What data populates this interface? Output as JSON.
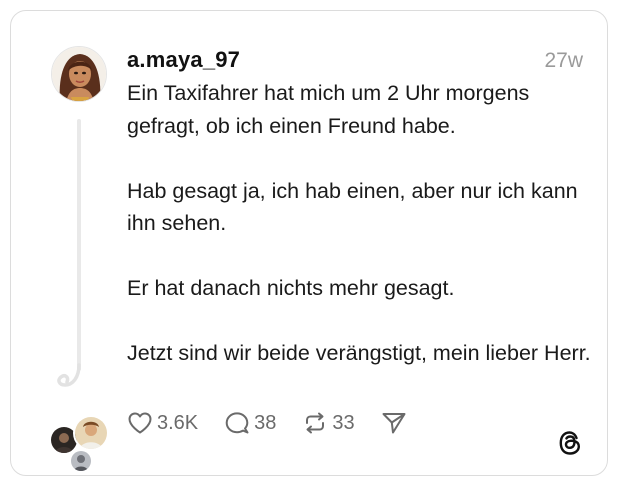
{
  "post": {
    "username": "a.maya_97",
    "timestamp": "27w",
    "paragraphs": [
      "Ein Taxifahrer hat mich um 2 Uhr morgens gefragt, ob ich einen Freund habe.",
      "Hab gesagt ja, ich hab einen, aber nur ich kann ihn sehen.",
      "Er hat danach nichts mehr gesagt.",
      "Jetzt sind wir beide verängstigt, mein lieber Herr."
    ]
  },
  "actions": {
    "likes": "3.6K",
    "replies": "38",
    "reposts": "33"
  },
  "icons": {
    "like": "heart-icon",
    "reply": "comment-icon",
    "repost": "repost-icon",
    "share": "send-icon",
    "brand": "threads-logo-icon"
  },
  "colors": {
    "text": "#111111",
    "muted": "#9a9a9a",
    "border": "#dcdcdc"
  }
}
